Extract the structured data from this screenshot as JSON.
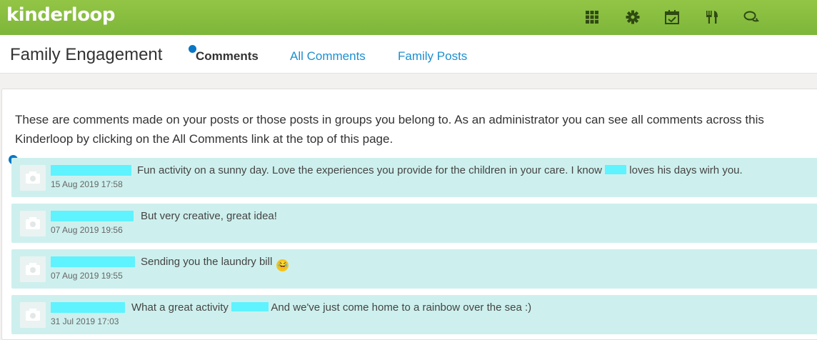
{
  "app": {
    "logo": "kinderloop",
    "colors": {
      "brand_green": "#8cc240",
      "link_blue": "#1d8fcf",
      "comment_bg": "#cdf0ee",
      "redaction": "#5ef3ff"
    },
    "nav_icons": [
      "apps-grid-icon",
      "settings-gear-icon",
      "calendar-check-icon",
      "fork-knife-icon",
      "chat-bubbles-icon"
    ]
  },
  "header": {
    "title": "Family Engagement",
    "tabs": [
      {
        "label": "Comments",
        "active": true
      },
      {
        "label": "All Comments",
        "active": false
      },
      {
        "label": "Family Posts",
        "active": false
      }
    ]
  },
  "intro": "These are comments made on your posts or those posts in groups you belong to. As an administrator you can see all comments across this Kinderloop by clicking on the All Comments link at the top of this page.",
  "comments": [
    {
      "text_before": "Fun activity on a sunny day. Love the experiences you provide for the children in your care. I know",
      "text_after": "loves his days wirh you.",
      "time": "15 Aug 2019 17:58"
    },
    {
      "text": "But very creative, great idea!",
      "time": "07 Aug 2019 19:56"
    },
    {
      "text": "Sending you the laundry bill",
      "emoji": "rolling-on-floor-laughing-emoji",
      "time": "07 Aug 2019 19:55"
    },
    {
      "text_before": "What a great activity",
      "text_after": "And we've just come home to a rainbow over the sea :)",
      "time": "31 Jul 2019 17:03"
    }
  ]
}
